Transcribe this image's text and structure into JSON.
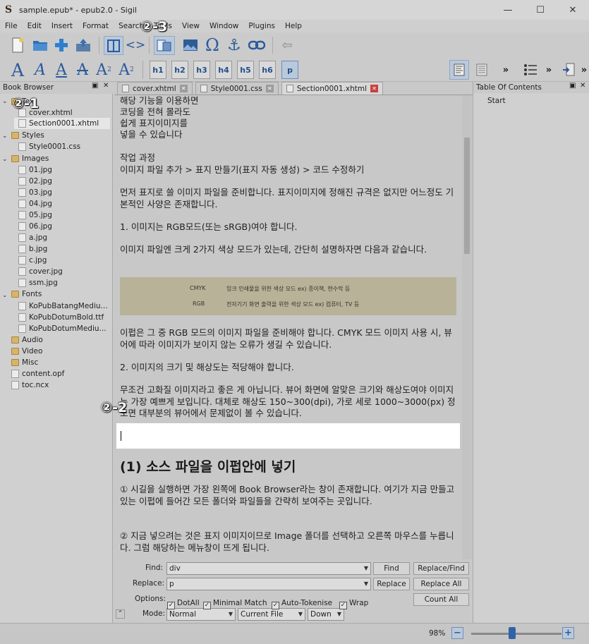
{
  "window": {
    "title": "sample.epub* - epub2.0 - Sigil",
    "controls": [
      "minimize",
      "maximize",
      "close"
    ]
  },
  "menu": [
    "File",
    "Edit",
    "Insert",
    "Format",
    "Search",
    "Tools",
    "View",
    "Window",
    "Plugins",
    "Help"
  ],
  "toolbar": {
    "heading_buttons": [
      "h1",
      "h2",
      "h3",
      "h4",
      "h5",
      "h6",
      "p"
    ],
    "more": "»"
  },
  "book_browser": {
    "title": "Book Browser",
    "folders": {
      "text": "Text",
      "styles": "Styles",
      "images": "Images",
      "fonts": "Fonts",
      "audio": "Audio",
      "video": "Video",
      "misc": "Misc"
    },
    "text_files": [
      "cover.xhtml",
      "Section0001.xhtml"
    ],
    "style_files": [
      "Style0001.css"
    ],
    "image_files": [
      "01.jpg",
      "02.jpg",
      "03.jpg",
      "04.jpg",
      "05.jpg",
      "06.jpg",
      "a.jpg",
      "b.jpg",
      "c.jpg",
      "cover.jpg",
      "ssm.jpg"
    ],
    "font_files": [
      "KoPubBatangMediu...",
      "KoPubDotumBold.ttf",
      "KoPubDotumMediu..."
    ],
    "root_files": [
      "content.opf",
      "toc.ncx"
    ]
  },
  "tabs": [
    {
      "label": "cover.xhtml"
    },
    {
      "label": "Style0001.css"
    },
    {
      "label": "Section0001.xhtml"
    }
  ],
  "editor": {
    "lines": [
      "해당 기능을 이용하면",
      "코딩을 전혀 몰라도",
      "쉽게 표지이미지를",
      "넣을 수 있습니다"
    ],
    "work_title": "작업 과정",
    "work_steps": "이미지 파일 추가 > 표지 만들기(표지 자동 생성) > 코드 수정하기",
    "p1": "먼저 표지로 쓸 이미지 파일을 준비합니다. 표지이미지에 정해진 규격은 없지만 어느정도 기본적인 사양은 존재합니다.",
    "p2": "1. 이미지는 RGB모드(또는 sRGB)여야 합니다.",
    "p3": "이미지 파일엔 크게 2가지 색상 모드가 있는데, 간단히 설명하자면 다음과 같습니다.",
    "table": [
      {
        "mode": "CMYK",
        "desc": "잉크 인쇄물을 위한 색상 모드 ex) 종이책, 현수막 등"
      },
      {
        "mode": "RGB",
        "desc": "전자기기 화면 출력을 위한 색상 모드 ex) 컴퓨터, TV 등"
      }
    ],
    "p4": "이펍은 그 중 RGB 모드의 이미지 파일을 준비해야 합니다. CMYK 모드 이미지 사용 시, 뷰어에 따라 이미지가 보이지 않는 오류가 생길 수 있습니다.",
    "p5": "2. 이미지의 크기 및 해상도는 적당해야 합니다.",
    "p6": "무조건 고화질 이미지라고 좋은 게 아닙니다. 뷰어 화면에 알맞은 크기와 해상도여야 이미지는 가장 예쁘게 보입니다. 대체로 해상도 150~300(dpi), 가로 세로 1000~3000(px) 정도면 대부분의 뷰어에서 문제없이 볼 수 있습니다.",
    "heading": "(1) 소스 파일을 이펍안에 넣기",
    "p7": "① 시길을 실행하면 가장 왼쪽에 Book Browser라는 창이 존재합니다. 여기가 지금 만들고 있는 이펍에 들어간 모든 폴더와 파일들을 간략히 보여주는 곳입니다.",
    "p8": "② 지금 넣으려는 것은 표지 이미지이므로 Image 폴더를 선택하고 오른쪽 마우스를 누릅니다. 그럼 해당하는 메뉴창이 뜨게 됩니다."
  },
  "toc": {
    "title": "Table Of Contents",
    "items": [
      "Start"
    ]
  },
  "find": {
    "find_label": "Find:",
    "find_value": "div",
    "replace_label": "Replace:",
    "replace_value": "p",
    "options_label": "Options:",
    "options": [
      {
        "label": "DotAll",
        "checked": true
      },
      {
        "label": "Minimal Match",
        "checked": true
      },
      {
        "label": "Auto-Tokenise",
        "checked": true
      },
      {
        "label": "Wrap",
        "checked": true
      }
    ],
    "mode_label": "Mode:",
    "mode_value": "Normal",
    "scope_value": "Current File",
    "direction_value": "Down",
    "buttons": {
      "find": "Find",
      "replace_find": "Replace/Find",
      "replace": "Replace",
      "replace_all": "Replace All",
      "count_all": "Count All"
    }
  },
  "status": {
    "zoom": "98%",
    "zoom_level": 0.45
  },
  "annotations": {
    "a1": "②-1",
    "a2": "②-2",
    "a3": "②-3"
  },
  "colors": {
    "accent": "#2a5a9c",
    "close_red": "#c8423e",
    "selection": "#b9c9dc"
  }
}
